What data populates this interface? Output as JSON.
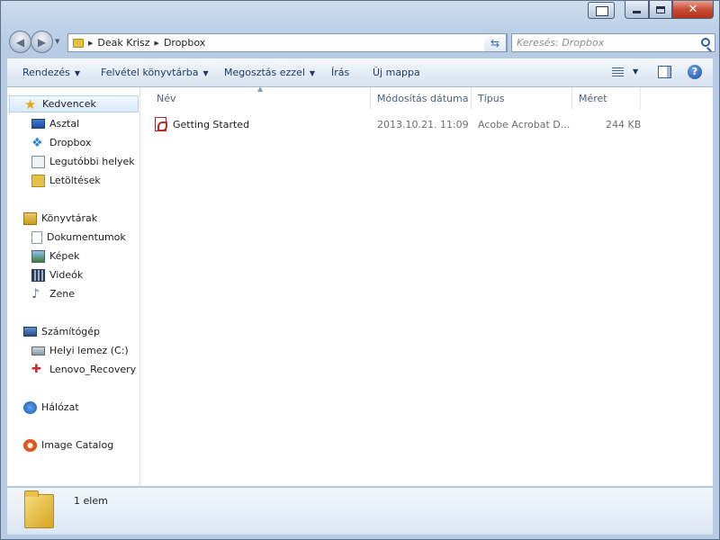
{
  "window": {
    "caption_min": "",
    "caption_max": "",
    "caption_close": "✕"
  },
  "address": {
    "crumbs": [
      "Deak Krisz",
      "Dropbox"
    ]
  },
  "search": {
    "placeholder": "Keresés: Dropbox"
  },
  "toolbar": {
    "organize": "Rendezés",
    "include_in_library": "Felvétel könyvtárba",
    "share_with": "Megosztás ezzel",
    "burn": "Írás",
    "new_folder": "Új mappa",
    "help": "?"
  },
  "nav": {
    "favorites": "Kedvencek",
    "desktop": "Asztal",
    "dropbox": "Dropbox",
    "recent_places": "Legutóbbi helyek",
    "downloads": "Letöltések",
    "libraries": "Könyvtárak",
    "documents": "Dokumentumok",
    "pictures": "Képek",
    "videos": "Videók",
    "music": "Zene",
    "computer": "Számítógép",
    "local_disk": "Helyi lemez (C:)",
    "recovery": "Lenovo_Recovery (D",
    "network": "Hálózat",
    "image_catalog": "Image Catalog"
  },
  "columns": {
    "name": "Név",
    "date_modified": "Módosítás dátuma",
    "type": "Típus",
    "size": "Méret"
  },
  "files": [
    {
      "name": "Getting Started",
      "date_modified": "2013.10.21. 11:09",
      "type": "Acobe Acrobat D...",
      "size": "244 KB",
      "icon": "pdf-icon"
    }
  ],
  "details": {
    "count": "1 elem"
  },
  "colors": {
    "accent": "#1e395b",
    "selection": "#d9e9fb",
    "close_button": "#c94c34"
  }
}
